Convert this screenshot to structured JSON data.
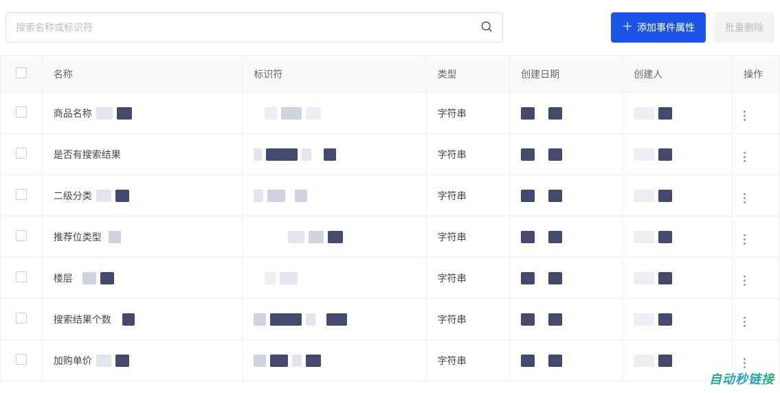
{
  "toolbar": {
    "search_placeholder": "搜索名称或标识符",
    "add_button_label": "添加事件属性",
    "bulk_delete_label": "批量删除"
  },
  "columns": {
    "name": "名称",
    "identifier": "标识符",
    "type": "类型",
    "created_date": "创建日期",
    "creator": "创建人",
    "operation": "操作"
  },
  "rows": [
    {
      "name": "商品名称",
      "type": "字符串"
    },
    {
      "name": "是否有搜索结果",
      "type": "字符串"
    },
    {
      "name": "二级分类",
      "type": "字符串"
    },
    {
      "name": "推荐位类型",
      "type": "字符串"
    },
    {
      "name": "楼层",
      "type": "字符串"
    },
    {
      "name": "搜索结果个数",
      "type": "字符串"
    },
    {
      "name": "加购单价",
      "type": "字符串"
    }
  ],
  "watermark": "自动秒链接"
}
